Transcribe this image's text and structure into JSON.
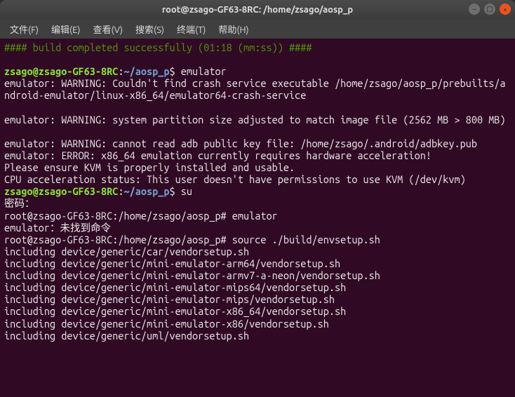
{
  "window": {
    "title": "root@zsago-GF63-8RC: /home/zsago/aosp_p"
  },
  "menu": {
    "file": "文件(F)",
    "edit": "编辑(E)",
    "view": "查看(V)",
    "search": "搜索(S)",
    "terminal": "终端(T)",
    "help": "帮助(H)"
  },
  "lines": {
    "l1": "#### build completed successfully (01:18 (mm:ss)) ####",
    "p1_user": "zsago@zsago-GF63-8RC",
    "p1_colon": ":",
    "p1_path": "~/aosp_p",
    "p1_dollar": "$ ",
    "p1_cmd": "emulator",
    "l2": "emulator: WARNING: Couldn't find crash service executable /home/zsago/aosp_p/prebuilts/android-emulator/linux-x86_64/emulator64-crash-service",
    "l3": "emulator: WARNING: system partition size adjusted to match image file (2562 MB > 800 MB)",
    "l4": "emulator: WARNING: cannot read adb public key file: /home/zsago/.android/adbkey.pub",
    "l5": "emulator: ERROR: x86_64 emulation currently requires hardware acceleration!",
    "l6": "Please ensure KVM is properly installed and usable.",
    "l7": "CPU acceleration status: This user doesn't have permissions to use KVM (/dev/kvm)",
    "p2_user": "zsago@zsago-GF63-8RC",
    "p2_colon": ":",
    "p2_path": "~/aosp_p",
    "p2_dollar": "$ ",
    "p2_cmd": "su",
    "l8": "密码：",
    "l9": "root@zsago-GF63-8RC:/home/zsago/aosp_p# emulator",
    "l10": "emulator：未找到命令",
    "l11": "root@zsago-GF63-8RC:/home/zsago/aosp_p# source ./build/envsetup.sh",
    "l12": "including device/generic/car/vendorsetup.sh",
    "l13": "including device/generic/mini-emulator-arm64/vendorsetup.sh",
    "l14": "including device/generic/mini-emulator-armv7-a-neon/vendorsetup.sh",
    "l15": "including device/generic/mini-emulator-mips64/vendorsetup.sh",
    "l16": "including device/generic/mini-emulator-mips/vendorsetup.sh",
    "l17": "including device/generic/mini-emulator-x86_64/vendorsetup.sh",
    "l18": "including device/generic/mini-emulator-x86/vendorsetup.sh",
    "l19": "including device/generic/uml/vendorsetup.sh"
  },
  "controls": {
    "min": "‒",
    "max": "□",
    "close": "×"
  }
}
